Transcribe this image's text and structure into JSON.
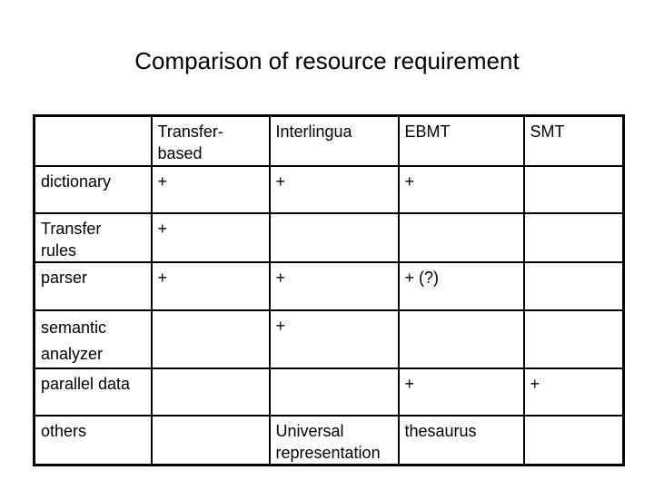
{
  "slide": {
    "title": "Comparison of resource requirement"
  },
  "table": {
    "headers": [
      "",
      "Transfer-based",
      "Interlingua",
      "EBMT",
      "SMT"
    ],
    "header_display": [
      "",
      "Transfer-\nbased",
      "Interlingua",
      "EBMT",
      "SMT"
    ],
    "rows": [
      {
        "label": "dictionary",
        "cells": [
          "+",
          "+",
          "+",
          ""
        ]
      },
      {
        "label": "Transfer rules",
        "cells": [
          "+",
          "",
          "",
          ""
        ]
      },
      {
        "label": "parser",
        "cells": [
          "+",
          "+",
          "+ (?)",
          ""
        ]
      },
      {
        "label": "semantic analyzer",
        "cells": [
          "",
          "+",
          "",
          ""
        ]
      },
      {
        "label": "parallel data",
        "cells": [
          "",
          "",
          "+",
          "+"
        ]
      },
      {
        "label": "others",
        "cells": [
          "",
          "Universal representation",
          "thesaurus",
          ""
        ]
      }
    ]
  }
}
